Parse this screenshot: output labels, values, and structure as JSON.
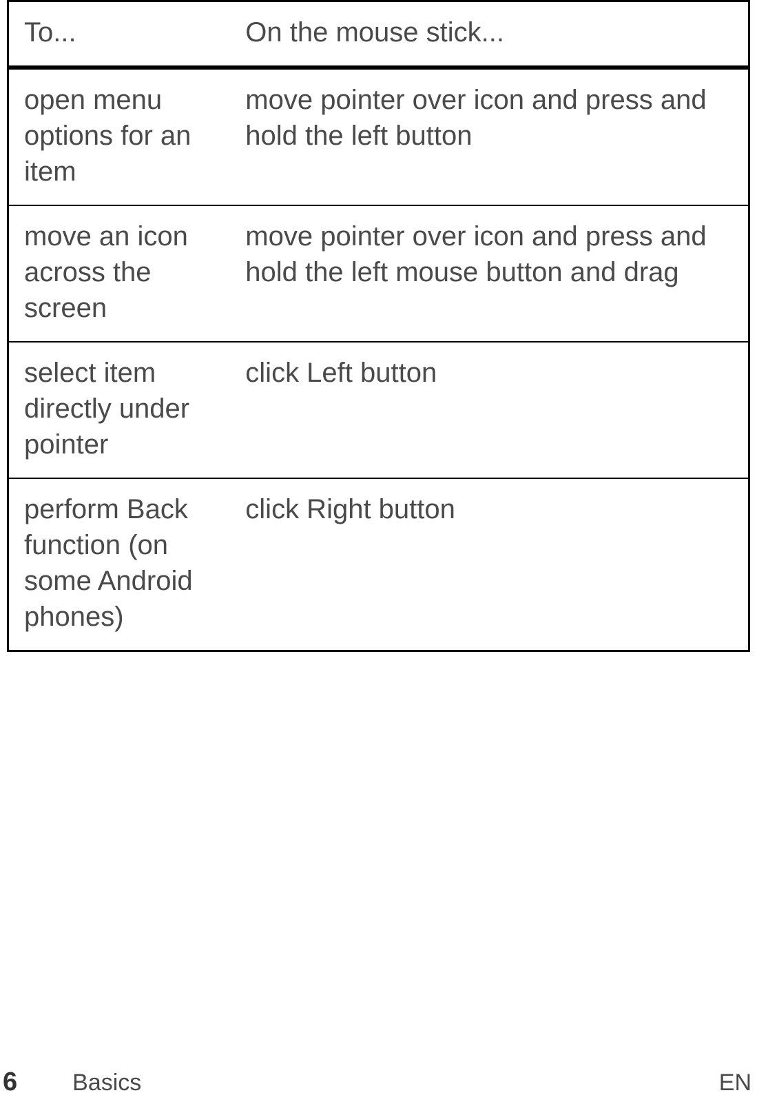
{
  "table": {
    "headers": {
      "col1": "To...",
      "col2": "On the mouse stick..."
    },
    "rows": [
      {
        "action": "open menu options for an item",
        "instruction": "move pointer over icon and press and hold the left button"
      },
      {
        "action": "move an icon across the screen",
        "instruction": "move pointer over icon and press and hold the left mouse button and drag"
      },
      {
        "action": "select item directly under pointer",
        "instruction": "click Left button"
      },
      {
        "action": "perform Back function (on some Android phones)",
        "instruction": "click Right button"
      }
    ]
  },
  "footer": {
    "page_number": "6",
    "section": "Basics",
    "language": "EN"
  }
}
